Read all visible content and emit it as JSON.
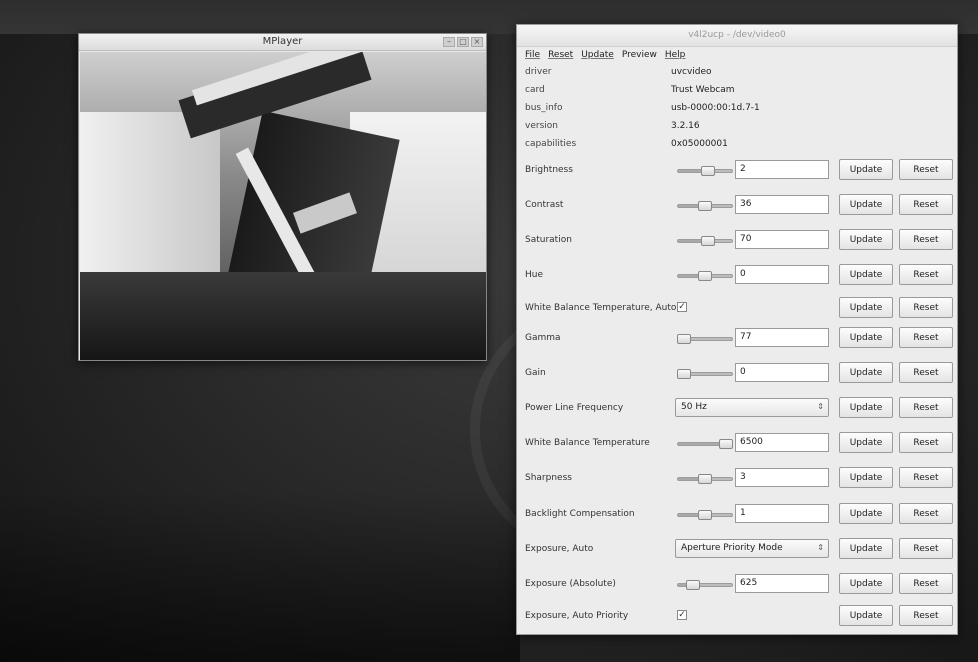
{
  "mplayer": {
    "title": "MPlayer"
  },
  "ucp": {
    "title": "v4l2ucp - /dev/video0",
    "menu": [
      "File",
      "Reset",
      "Update",
      "Preview",
      "Help"
    ],
    "info": [
      {
        "key": "driver",
        "value": "uvcvideo"
      },
      {
        "key": "card",
        "value": "Trust Webcam"
      },
      {
        "key": "bus_info",
        "value": "usb-0000:00:1d.7-1"
      },
      {
        "key": "version",
        "value": "3.2.16"
      },
      {
        "key": "capabilities",
        "value": "0x05000001"
      }
    ],
    "update_label": "Update",
    "reset_label": "Reset",
    "controls": [
      {
        "label": "Brightness",
        "type": "slider",
        "value": "2",
        "level": 0.55
      },
      {
        "label": "Contrast",
        "type": "slider",
        "value": "36",
        "level": 0.5
      },
      {
        "label": "Saturation",
        "type": "slider",
        "value": "70",
        "level": 0.55
      },
      {
        "label": "Hue",
        "type": "slider",
        "value": "0",
        "level": 0.5
      },
      {
        "label": "White Balance Temperature, Auto",
        "type": "checkbox",
        "checked": true
      },
      {
        "label": "Gamma",
        "type": "slider",
        "value": "77",
        "level": 0.12
      },
      {
        "label": "Gain",
        "type": "slider",
        "value": "0",
        "level": 0.12
      },
      {
        "label": "Power Line Frequency",
        "type": "combo",
        "value": "50 Hz"
      },
      {
        "label": "White Balance Temperature",
        "type": "slider",
        "value": "6500",
        "level": 0.88
      },
      {
        "label": "Sharpness",
        "type": "slider",
        "value": "3",
        "level": 0.5
      },
      {
        "label": "Backlight Compensation",
        "type": "slider",
        "value": "1",
        "level": 0.5
      },
      {
        "label": "Exposure, Auto",
        "type": "combo",
        "value": "Aperture Priority Mode"
      },
      {
        "label": "Exposure (Absolute)",
        "type": "slider",
        "value": "625",
        "level": 0.28
      },
      {
        "label": "Exposure, Auto Priority",
        "type": "checkbox",
        "checked": true,
        "no_reset_gap": true
      }
    ]
  }
}
